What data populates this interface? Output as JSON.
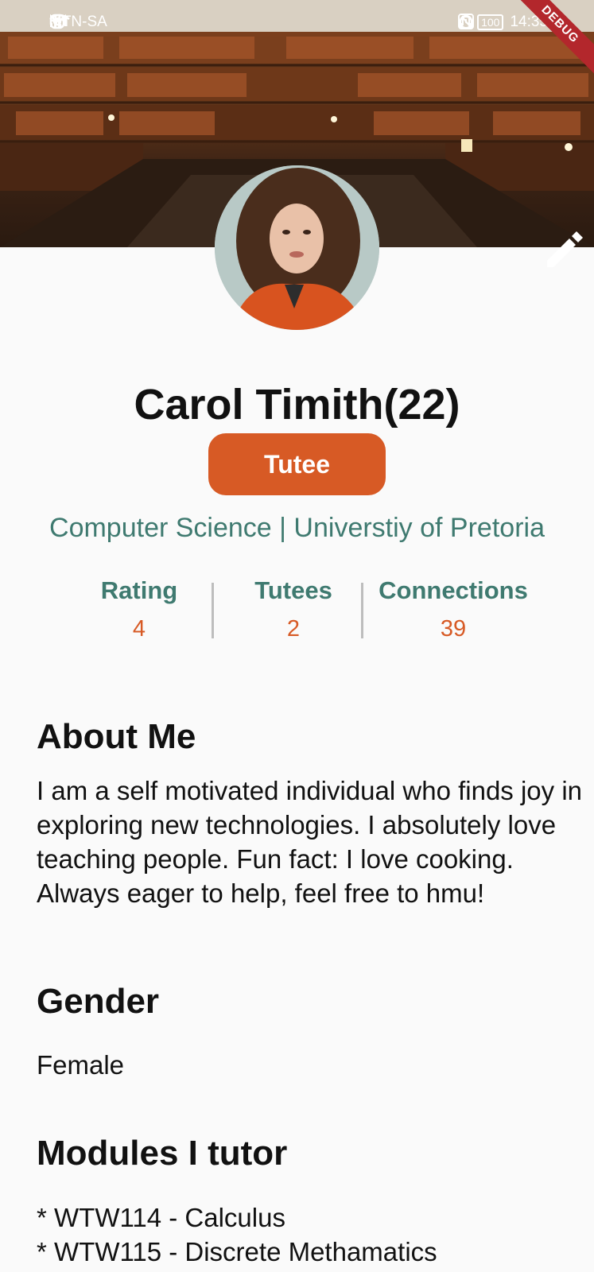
{
  "status_bar": {
    "carrier": "MTN-SA",
    "network": "36",
    "time": "14:35",
    "battery": "100",
    "debug_label": "DEBUG"
  },
  "profile": {
    "name": "Carol Timith(22)",
    "role": "Tutee",
    "institution": "Computer Science | Universtiy of Pretoria"
  },
  "stats": [
    {
      "label": "Rating",
      "value": "4"
    },
    {
      "label": "Tutees",
      "value": "2"
    },
    {
      "label": "Connections",
      "value": "39"
    }
  ],
  "about": {
    "title": "About Me",
    "text": "I am a self motivated individual who finds joy in exploring new technologies. I absolutely love teaching people. Fun fact: I love cooking. Always eager to help, feel free to hmu!"
  },
  "gender": {
    "title": "Gender",
    "value": "Female"
  },
  "modules": {
    "title": "Modules I tutor",
    "items": [
      "* WTW114 - Calculus",
      "* WTW115 - Discrete Methamatics"
    ]
  },
  "colors": {
    "accent": "#d75a25",
    "teal": "#3f7a70",
    "background": "#fafafa"
  },
  "icons": [
    "edit-pencil-icon",
    "signal-icon",
    "wifi-icon",
    "alarm-icon",
    "headphones-icon",
    "nfc-icon"
  ]
}
